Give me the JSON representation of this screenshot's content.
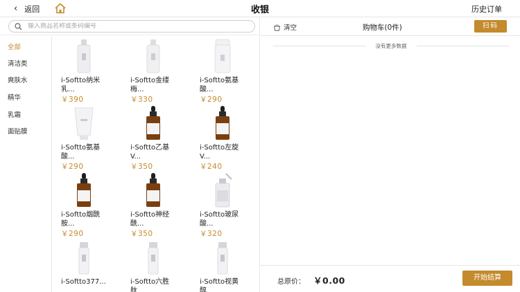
{
  "topbar": {
    "back_label": "返回",
    "title": "收银",
    "history_label": "历史订单"
  },
  "search": {
    "placeholder": "输入商品名称或条码编号"
  },
  "categories": [
    {
      "label": "全部",
      "active": true
    },
    {
      "label": "清洁类",
      "active": false
    },
    {
      "label": "爽肤水",
      "active": false
    },
    {
      "label": "精华",
      "active": false
    },
    {
      "label": "乳霜",
      "active": false
    },
    {
      "label": "面贴膜",
      "active": false
    }
  ],
  "products": [
    {
      "line1": "i-Softto纳米",
      "line2": "乳...",
      "price": "￥390",
      "icon": "white-bottle-icon"
    },
    {
      "line1": "i-Softto金缕",
      "line2": "梅...",
      "price": "￥330",
      "icon": "white-bottle-icon"
    },
    {
      "line1": "i-Softto氨基",
      "line2": "酸...",
      "price": "￥290",
      "icon": "foam-pump-bottle-icon"
    },
    {
      "line1": "i-Softto氨基",
      "line2": "酸...",
      "price": "￥290",
      "icon": "tube-icon"
    },
    {
      "line1": "i-Softto乙基",
      "line2": "V...",
      "price": "￥350",
      "icon": "dropper-bottle-icon"
    },
    {
      "line1": "i-Softto左旋",
      "line2": "V...",
      "price": "￥240",
      "icon": "dropper-bottle-icon"
    },
    {
      "line1": "i-Softto烟酰",
      "line2": "胺...",
      "price": "￥290",
      "icon": "dropper-bottle-icon"
    },
    {
      "line1": "i-Softto神经",
      "line2": "酰...",
      "price": "￥350",
      "icon": "dropper-bottle-icon"
    },
    {
      "line1": "i-Softto玻尿",
      "line2": "酸...",
      "price": "￥320",
      "icon": "clear-dropper-bottle-icon"
    },
    {
      "line1": "i-Softto377...",
      "line2": "",
      "price": "",
      "icon": "slim-bottle-icon"
    },
    {
      "line1": "i-Softto六胜",
      "line2": "肽",
      "price": "",
      "icon": "slim-bottle-icon"
    },
    {
      "line1": "i-Softto视黄",
      "line2": "醇",
      "price": "",
      "icon": "slim-bottle-icon"
    }
  ],
  "cart": {
    "clear_label": "清空",
    "title": "购物车(0件)",
    "scan_label": "扫码",
    "empty_text": "没有更多数据",
    "total_label": "总原价：",
    "total_value": "￥0.00",
    "checkout_label": "开始结算"
  },
  "colors": {
    "accent": "#c48a2c"
  }
}
